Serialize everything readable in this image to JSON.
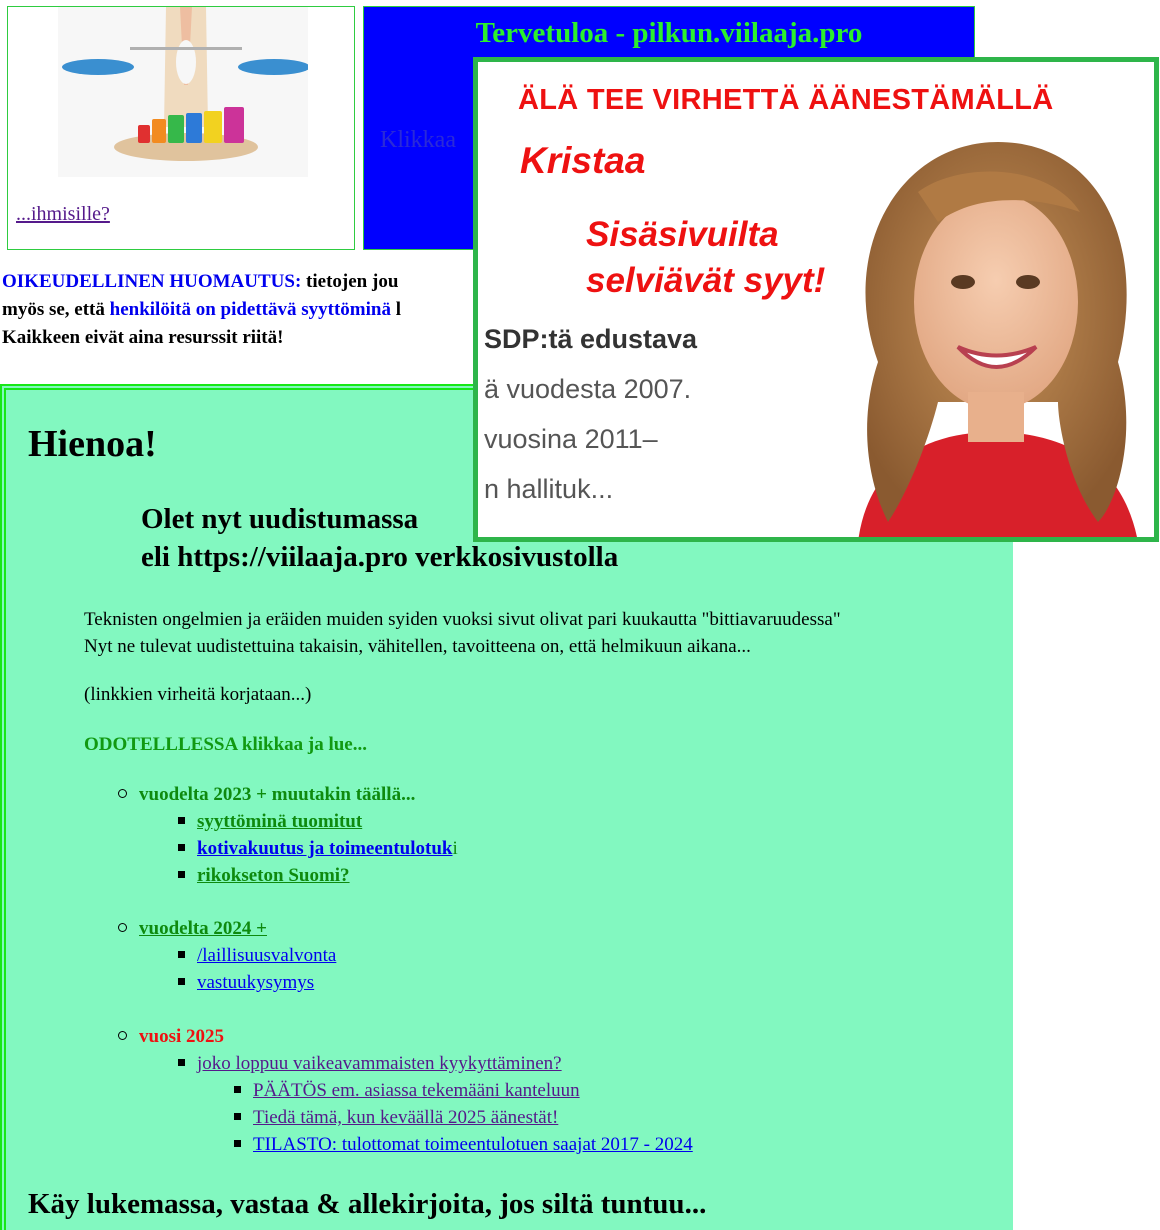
{
  "top": {
    "scale_link": "...ihmisille?",
    "welcome_title": "Tervetuloa - pilkun.viilaaja.pro",
    "welcome_hidden": "Klikkaa"
  },
  "legal": {
    "label": "OIKEUDELLINEN HUOMAUTUS:",
    "line1_rest": " tietojen jou",
    "line2_start": "myös se, että ",
    "line2_blue": "henkilöitä on pidettävä syyttöminä",
    "line2_end": " l",
    "line3": "Kaikkeen eivät aina resurssit riitä!"
  },
  "main": {
    "title": "Hienoa!",
    "subhead_line1": "Olet nyt uudistumassa",
    "subhead_line2": "eli https://viilaaja.pro verkkosivustolla",
    "intro_line1": "Teknisten ongelmien ja eräiden muiden syiden vuoksi sivut olivat pari kuukautta \"bittiavaruudessa\"",
    "intro_line2": "Nyt ne tulevat uudistettuina takaisin, vähitellen, tavoitteena on, että helmikuun aikana...",
    "fix_note": "(linkkien virheitä korjataan...)",
    "wait_note": "ODOTELLLESSA klikkaa ja lue...",
    "year2023": {
      "label": "vuodelta 2023 + muutakin täällä...",
      "items": [
        "syyttöminä tuomitut",
        "kotivakuutus ja toimeentulotuk",
        "rikokseton Suomi?"
      ],
      "item2_suffix": "i"
    },
    "year2024": {
      "label": "vuodelta 2024 +",
      "items": [
        "/laillisuusvalvonta",
        "vastuukysymys"
      ]
    },
    "year2025": {
      "label": "vuosi 2025",
      "item": "joko loppuu vaikeavammaisten kyykyttäminen?",
      "subitems": [
        "PÄÄTÖS em. asiassa tekemääni kanteluun",
        "Tiedä tämä, kun keväällä 2025 äänestät!",
        "TILASTO: tulottomat toimeentulotuen saajat 2017 - 2024"
      ]
    },
    "bottom_heading": "Käy lukemassa, vastaa & allekirjoita, jos siltä tuntuu..."
  },
  "ad": {
    "headline": "ÄLÄ TEE VIRHETTÄ ÄÄNESTÄMÄLLÄ",
    "name": "Kristaa",
    "cta_line1": "Sisäsivuilta",
    "cta_line2": "selviävät syyt!",
    "snippet": [
      "SDP:tä edustava",
      "ä vuodesta 2007.",
      "vuosina 2011–",
      "n hallituk..."
    ]
  },
  "colors": {
    "welcome_bg": "#0000ff",
    "welcome_text": "#2cf02c",
    "panel_bg": "#82f8c0",
    "panel_border": "#17e817",
    "ad_border": "#2eb54a",
    "ad_red": "#ee1111"
  }
}
